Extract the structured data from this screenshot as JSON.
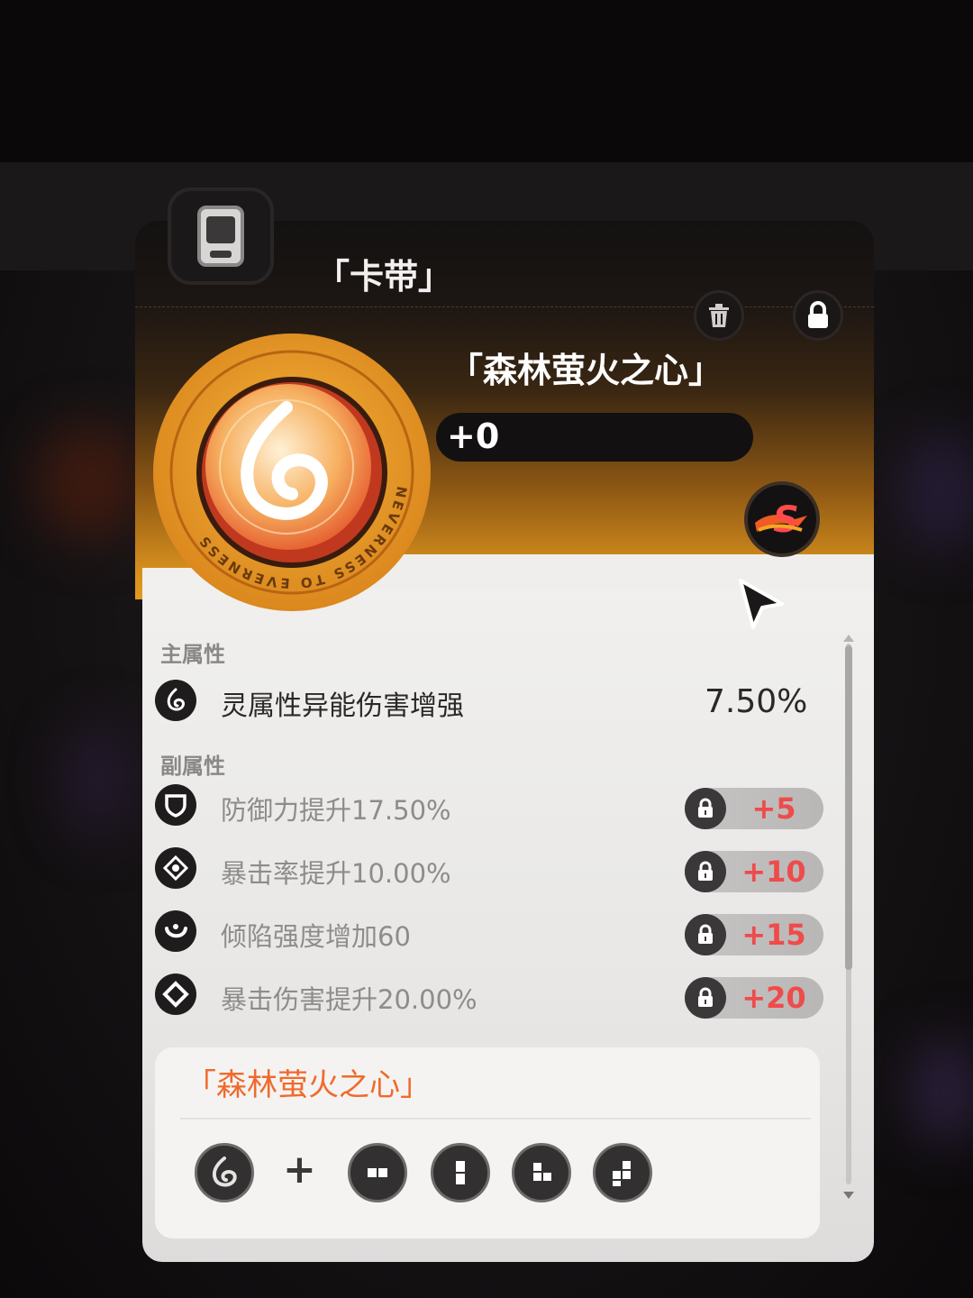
{
  "category": {
    "title": "「卡带」",
    "icon": "cassette-icon"
  },
  "actions": {
    "delete_icon": "trash-icon",
    "lock_icon": "lock-icon"
  },
  "item": {
    "name": "「森林萤火之心」",
    "level": "+0",
    "rank_icon": "s-rank-icon",
    "disc_ring_text": "NEVERNESS TO EVERNESS"
  },
  "main_stat": {
    "section_label": "主属性",
    "icon": "spirit-element-icon",
    "name": "灵属性异能伤害增强",
    "value": "7.50%"
  },
  "sub_stats": {
    "section_label": "副属性",
    "items": [
      {
        "icon": "shield-icon",
        "text": "防御力提升17.50%",
        "unlock": "+5"
      },
      {
        "icon": "crit-rate-icon",
        "text": "暴击率提升10.00%",
        "unlock": "+10"
      },
      {
        "icon": "break-icon",
        "text": "倾陷强度增加60",
        "unlock": "+15"
      },
      {
        "icon": "crit-damage-icon",
        "text": "暴击伤害提升20.00%",
        "unlock": "+20"
      }
    ]
  },
  "set_bonus": {
    "title": "「森林萤火之心」",
    "plus": "+",
    "icons": [
      "spirit-element-icon",
      "slot-horizontal-icon",
      "slot-vertical-icon",
      "slot-l-shape-icon",
      "slot-s-shape-icon"
    ]
  },
  "colors": {
    "accent_orange": "#e39a22",
    "set_title": "#f06a2c",
    "unlock_red": "#ef4b4b"
  }
}
